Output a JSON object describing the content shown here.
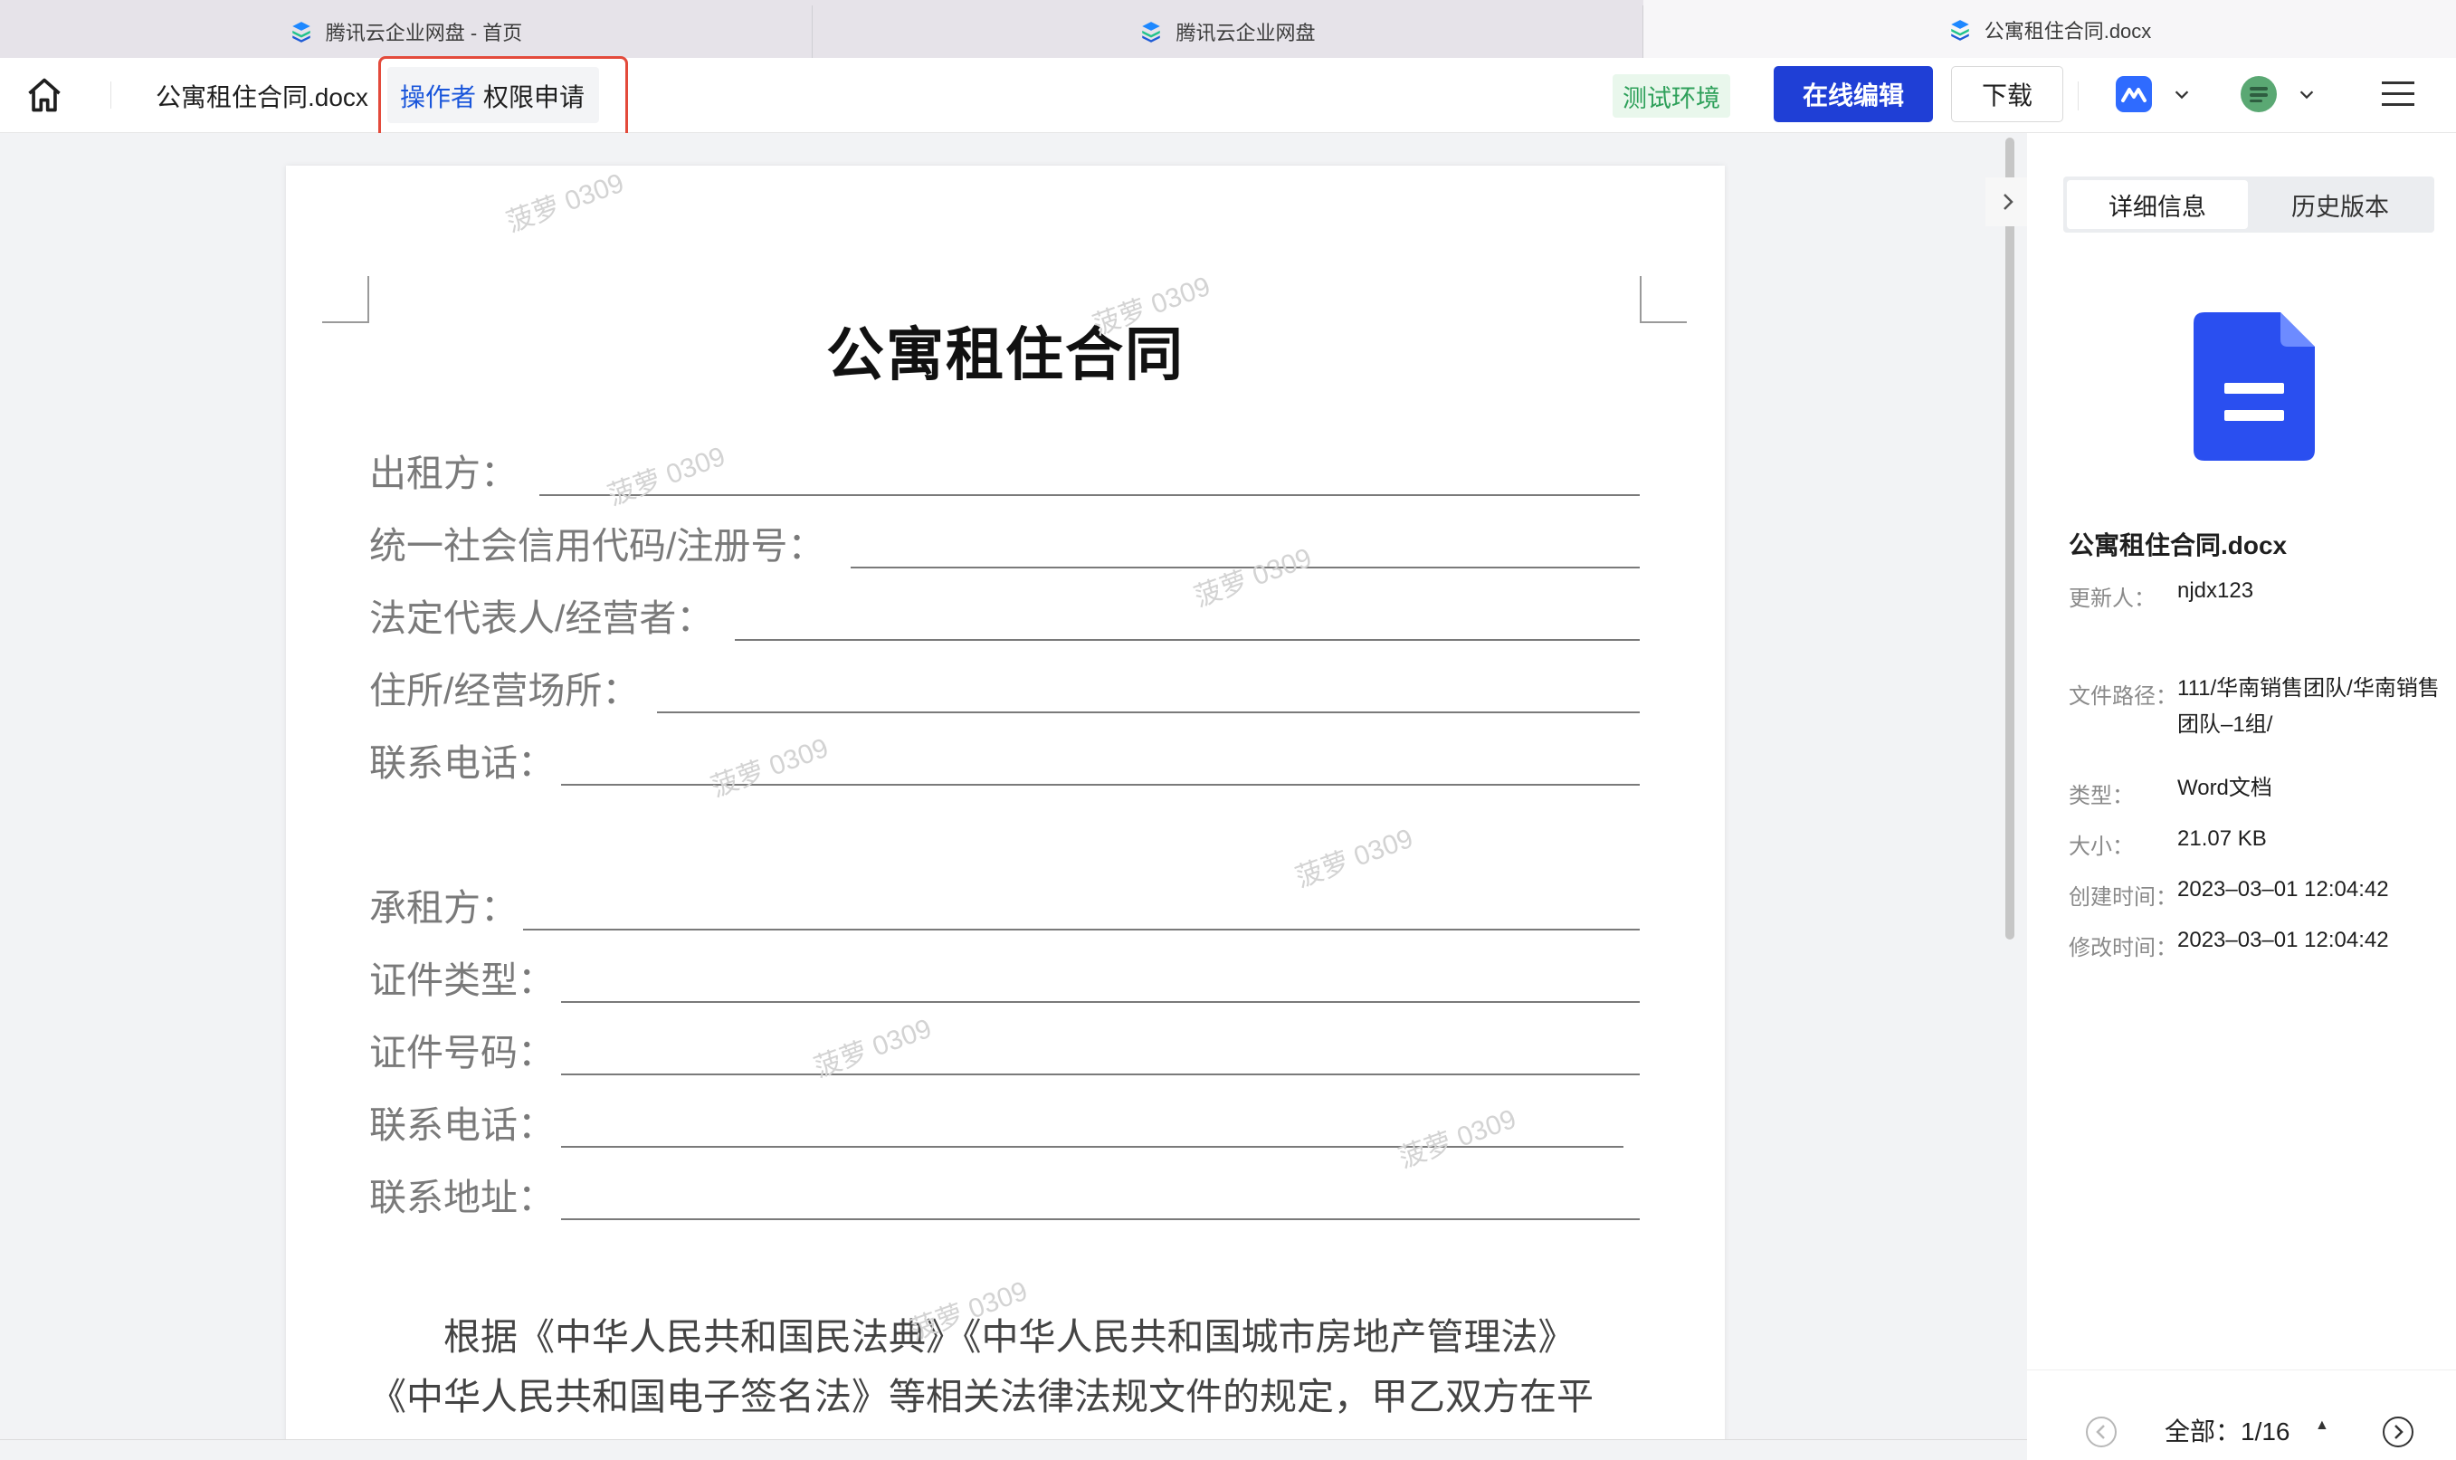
{
  "browser_tabs": [
    {
      "title": "腾讯云企业网盘 - 首页",
      "icon": "tencent-cloud-drive-icon"
    },
    {
      "title": "腾讯云企业网盘",
      "icon": "tencent-cloud-drive-icon"
    },
    {
      "title": "公寓租住合同.docx",
      "icon": "tencent-cloud-drive-icon"
    }
  ],
  "toolbar": {
    "doc_title": "公寓租住合同.docx",
    "operator_label": "操作者",
    "permission_request_label": "权限申请",
    "env_badge": "测试环境",
    "edit_label": "在线编辑",
    "download_label": "下载"
  },
  "document": {
    "title": "公寓租住合同",
    "lessor_fields": [
      "出租方：",
      "统一社会信用代码/注册号：",
      "法定代表人/经营者：",
      "住所/经营场所：",
      "联系电话："
    ],
    "lessee_fields": [
      "承租方：",
      "证件类型：",
      "证件号码：",
      "联系电话：",
      "联系地址："
    ],
    "para_line1": "根据《中华人民共和国民法典》《中华人民共和国城市房地产管理法》",
    "para_line2": "《中华人民共和国电子签名法》等相关法律法规文件的规定，甲乙双方在平",
    "watermark": "菠萝 0309"
  },
  "side_panel": {
    "tabs": [
      "详细信息",
      "历史版本"
    ],
    "file_name": "公寓租住合同.docx",
    "updater_label": "更新人：",
    "updater": "njdx123",
    "path_label": "文件路径：",
    "path": "111/华南销售团队/华南销售团队–1组/",
    "type_label": "类型：",
    "type": "Word文档",
    "size_label": "大小：",
    "size": "21.07 KB",
    "created_label": "创建时间：",
    "created": "2023–03–01 12:04:42",
    "modified_label": "修改时间：",
    "modified": "2023–03–01 12:04:42",
    "page_count": "全部：1/16"
  },
  "colors": {
    "accent": "#1f3fd6",
    "highlight_border": "#e34a3b",
    "env_green": "#2ea05a",
    "file_icon": "#2a4ff0"
  }
}
